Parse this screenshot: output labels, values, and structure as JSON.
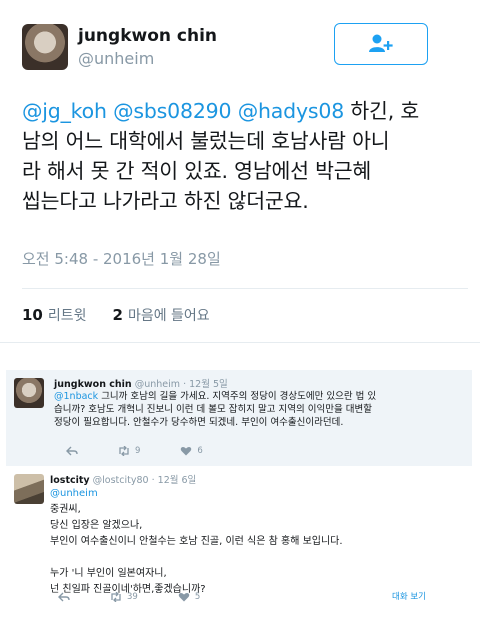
{
  "main_tweet": {
    "name": "jungkwon chin",
    "handle": "@unheim",
    "mentions": [
      "@jg_koh",
      "@sbs08290",
      "@hadys08"
    ],
    "text_line1_suffix": "하긴, 호",
    "text_line2": "남의 어느 대학에서 불렀는데 호남사람 아니",
    "text_line3": "라 해서 못 간 적이 있죠. 영남에선 박근혜",
    "text_line4": "씹는다고 나가라고 하진 않더군요.",
    "timestamp": "오전 5:48 - 2016년 1월 28일",
    "retweets_count": "10",
    "retweets_label": "리트윗",
    "likes_count": "2",
    "likes_label": "마음에 들어요",
    "follow_icon": "follow-user-icon",
    "accent_color": "#1da1f2"
  },
  "thread": [
    {
      "name": "jungkwon chin",
      "handle": "@unheim",
      "date": "· 12월 5일",
      "mention": "@1nback",
      "line1_suffix": "그니까 호남의 길을 가세요. 지역주의 정당이 경상도에만 있으란 법 있",
      "line2": "습니까? 호남도 개혁니 진보니 이런 데 볼모 잡히지 말고 지역의 이익만을 대변할",
      "line3": "정당이 필요합니다. 안철수가 당수하면 되겠네. 부인이 여수출신이라던데.",
      "retweets": "9",
      "likes": "6"
    },
    {
      "name": "lostcity",
      "handle": "@lostcity80",
      "date": "· 12월 6일",
      "mention": "@unheim",
      "line1": "중권씨,",
      "line2": "당신 입장은 알겠으나,",
      "line3": "부인이 여수출신이니 안철수는 호남 진골, 이런 식은 참 홍해 보입니다.",
      "line4": "누가 '니 부인이 일본여자니,",
      "line5": "넌 친일파 진골이네'하면,좋겠습니까?",
      "retweets": "39",
      "likes": "5",
      "view_conversation": "대화 보기"
    }
  ]
}
